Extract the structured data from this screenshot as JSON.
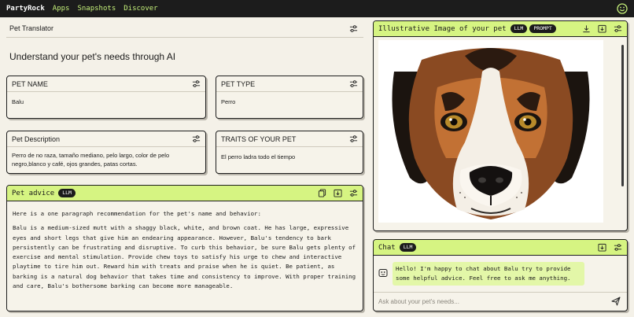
{
  "topbar": {
    "brand": "PartyRock",
    "nav": [
      "Apps",
      "Snapshots",
      "Discover"
    ],
    "avatar_icon": "smiley-icon"
  },
  "app": {
    "title": "Pet Translator",
    "heading": "Understand your pet's needs through AI"
  },
  "widgets": {
    "pet_name": {
      "title": "PET NAME",
      "value": "Balu"
    },
    "pet_type": {
      "title": "PET TYPE",
      "value": "Perro"
    },
    "pet_description": {
      "title": "Pet Description",
      "value": "Perro de no raza, tamaño mediano, pelo largo, color de pelo negro,blanco y café, ojos grandes, patas cortas."
    },
    "traits": {
      "title": "TRAITS OF YOUR PET",
      "value": "El perro ladra todo el tiempo"
    },
    "pet_advice": {
      "title": "Pet advice",
      "badge": "LLM",
      "intro": "Here is a one paragraph recommendation for the pet's name and behavior:",
      "body": "Balu is a medium-sized mutt with a shaggy black, white, and brown coat. He has large, expressive eyes and short legs that give him an endearing appearance. However, Balu's tendency to bark persistently can be frustrating and disruptive. To curb this behavior, be sure Balu gets plenty of exercise and mental stimulation. Provide chew toys to satisfy his urge to chew and interactive playtime to tire him out. Reward him with treats and praise when he is quiet. Be patient, as barking is a natural dog behavior that takes time and consistency to improve. With proper training and care, Balu's bothersome barking can become more manageable."
    },
    "image": {
      "title": "Illustrative Image of your pet",
      "badges": [
        "LLM",
        "PROMPT"
      ]
    },
    "chat": {
      "title": "Chat",
      "badge": "LLM",
      "message": "Hello! I'm happy to chat about Balu try to provide some helpful advice. Feel free to ask me anything.",
      "placeholder": "Ask about your pet's needs..."
    }
  },
  "colors": {
    "accent": "#d6f482",
    "background": "#f4f1e8",
    "topbar": "#1c1c1c",
    "link": "#c5f07a"
  }
}
